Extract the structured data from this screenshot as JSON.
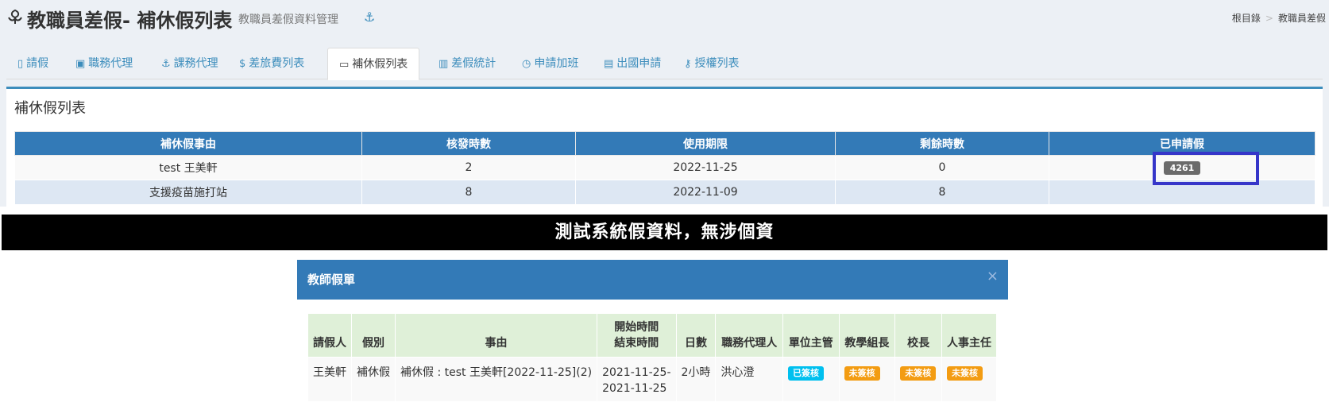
{
  "header": {
    "title": "教職員差假- 補休假列表",
    "subtitle": "教職員差假資料管理",
    "breadcrumb": [
      "根目錄",
      "教職員差假"
    ]
  },
  "tabs": [
    {
      "label": "請假",
      "icon": "file-icon"
    },
    {
      "label": "職務代理",
      "icon": "bus-icon"
    },
    {
      "label": "課務代理",
      "icon": "anchor-icon"
    },
    {
      "label": "差旅費列表",
      "icon": "dollar-icon"
    },
    {
      "label": "補休假列表",
      "icon": "battery-icon",
      "active": true
    },
    {
      "label": "差假統計",
      "icon": "bar-chart-icon"
    },
    {
      "label": "申請加班",
      "icon": "clock-icon"
    },
    {
      "label": "出國申請",
      "icon": "document-icon"
    },
    {
      "label": "授權列表",
      "icon": "key-icon"
    }
  ],
  "box": {
    "title": "補休假列表",
    "columns": [
      "補休假事由",
      "核發時數",
      "使用期限",
      "剩餘時數",
      "已申請假"
    ],
    "rows": [
      {
        "reason": "test 王美軒",
        "hours": "2",
        "expiry": "2022-11-25",
        "remaining": "0",
        "applied": "4261"
      },
      {
        "reason": "支援疫苗施打站",
        "hours": "8",
        "expiry": "2022-11-09",
        "remaining": "8",
        "applied": ""
      }
    ]
  },
  "banner": {
    "text": "測試系統假資料，無涉個資"
  },
  "modal": {
    "title": "教師假單",
    "close": "×",
    "columns": {
      "applicant": "請假人",
      "type": "假別",
      "reason": "事由",
      "start_label": "開始時間",
      "end_label": "結束時間",
      "days": "日數",
      "agent": "職務代理人",
      "supervisor": "單位主管",
      "academic": "教學組長",
      "principal": "校長",
      "personnel": "人事主任"
    },
    "row": {
      "applicant": "王美軒",
      "type": "補休假",
      "reason": "補休假 : test 王美軒[2022-11-25](2)",
      "start": "2021-11-25-",
      "end": "2021-11-25",
      "days": "2小時",
      "agent": "洪心澄",
      "supervisor": "已簽核",
      "academic": "未簽核",
      "principal": "未簽核",
      "personnel": "未簽核"
    }
  },
  "colors": {
    "primary": "#337ab7",
    "accent": "#3c8dbc",
    "signed": "#00c0ef",
    "unsigned": "#f39c12",
    "highlight": "#3636c9"
  }
}
